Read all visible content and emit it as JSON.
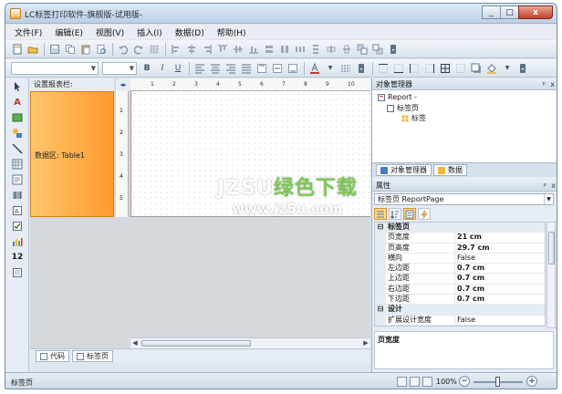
{
  "window": {
    "title": "LC标签打印软件-旗舰版-试用版-",
    "minimize": "_",
    "maximize": "□",
    "close": "x"
  },
  "menu": [
    "文件(F)",
    "编辑(E)",
    "视图(V)",
    "插入(I)",
    "数据(D)",
    "帮助(H)"
  ],
  "toolbar2": {
    "bold": "B",
    "italic": "I",
    "underline": "U"
  },
  "left_tools": {
    "text_tool": "A",
    "barcode_label": "12"
  },
  "design": {
    "band_header": "设置报表栏:",
    "band_label": "数据区: Table1",
    "ruler_corner": "◂▸",
    "ruler_marks": [
      "1",
      "2",
      "3",
      "4",
      "5",
      "6",
      "7",
      "8",
      "9",
      "10"
    ]
  },
  "bottom_tabs": [
    "代码",
    "标签页"
  ],
  "object_manager": {
    "title": "对象管理器",
    "pin": "ᵖ",
    "close": "x",
    "tree": [
      {
        "label": "Report -",
        "indent": 0
      },
      {
        "label": "标签页",
        "indent": 1
      },
      {
        "label": "标签",
        "indent": 2
      }
    ],
    "tabs": [
      "对象管理器",
      "数据"
    ]
  },
  "properties": {
    "title": "属性",
    "pin": "ᵖ",
    "close": "x",
    "selected_object": "标签页 ReportPage",
    "rows": [
      {
        "kind": "cat",
        "sign": "⊟",
        "name": "标签页"
      },
      {
        "kind": "prop",
        "name": "页宽度",
        "value": "21 cm",
        "bold": true
      },
      {
        "kind": "prop",
        "name": "页高度",
        "value": "29.7 cm",
        "bold": true
      },
      {
        "kind": "prop",
        "name": "横向",
        "value": "False",
        "bold": false
      },
      {
        "kind": "prop",
        "name": "左边距",
        "value": "0.7 cm",
        "bold": true
      },
      {
        "kind": "prop",
        "name": "上边距",
        "value": "0.7 cm",
        "bold": true
      },
      {
        "kind": "prop",
        "name": "右边距",
        "value": "0.7 cm",
        "bold": true
      },
      {
        "kind": "prop",
        "name": "下边距",
        "value": "0.7 cm",
        "bold": true
      },
      {
        "kind": "cat",
        "sign": "⊟",
        "name": "设计"
      },
      {
        "kind": "prop",
        "name": "扩展设计宽度",
        "value": "False",
        "bold": false
      }
    ],
    "description": "页宽度"
  },
  "status": {
    "text": "标签页",
    "zoom": "100%",
    "zoom_minus": "−",
    "zoom_plus": "+"
  },
  "watermark": {
    "main_a": "JZSU",
    "main_b": "绿色下载",
    "url": "www.jz5u.com"
  },
  "colors": {
    "band_fill": "#ff9a2e",
    "title_bar": "#bcd0e6",
    "close_button": "#c4412b"
  }
}
